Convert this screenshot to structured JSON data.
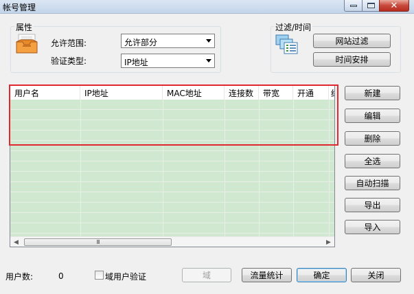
{
  "window": {
    "title": "帐号管理",
    "controls": {
      "minimize": "—",
      "maximize": "□",
      "close": "✕"
    }
  },
  "attributes": {
    "group_title": "属性",
    "icon": "inbox-tray-icon",
    "allow_scope_label": "允许范围:",
    "allow_scope_value": "允许部分",
    "auth_type_label": "验证类型:",
    "auth_type_value": "IP地址"
  },
  "filter_time": {
    "group_title": "过滤/时间",
    "icon": "list-windows-icon",
    "site_filter_label": "网站过滤",
    "schedule_label": "时间安排"
  },
  "table": {
    "columns": [
      "用户名",
      "IP地址",
      "MAC地址",
      "连接数",
      "带宽",
      "开通",
      "结"
    ],
    "rows": [],
    "row_bg": "#cfe8cf",
    "scroll_thumb_glyph": "III"
  },
  "side_buttons": {
    "new": "新建",
    "edit": "编辑",
    "delete": "删除",
    "select_all": "全选",
    "auto_scan": "自动扫描",
    "export": "导出",
    "import": "导入"
  },
  "footer": {
    "user_count_label": "用户数:",
    "user_count_value": "0",
    "domain_auth_label": "域用户验证",
    "domain_button": "域",
    "traffic_stats": "流量统计",
    "ok": "确定",
    "close": "关闭"
  },
  "highlight_color": "#e0262e"
}
